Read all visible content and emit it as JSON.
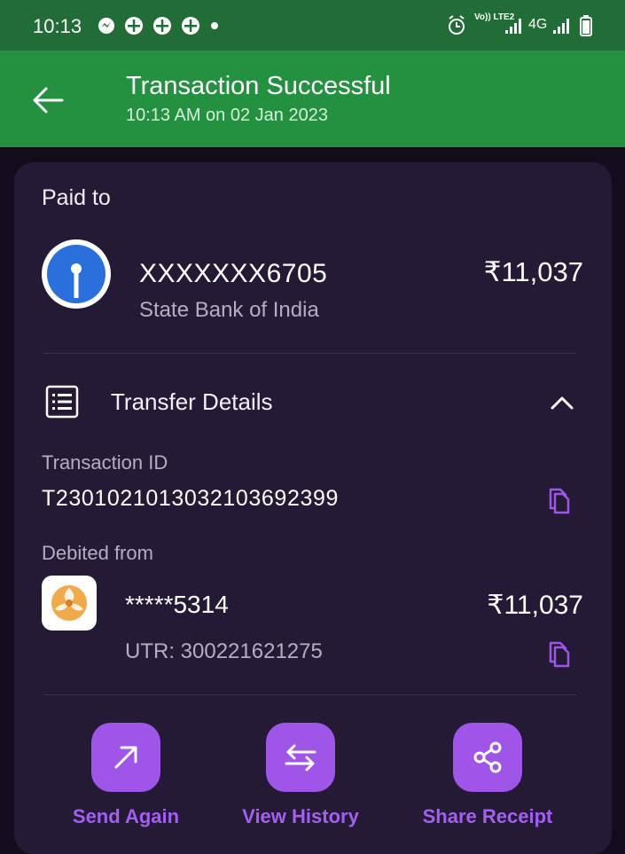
{
  "status_bar": {
    "time": "10:13",
    "network": "4G",
    "volte": "Vo)) LTE2"
  },
  "header": {
    "title": "Transaction Successful",
    "subtitle": "10:13 AM on 02 Jan 2023"
  },
  "paid_to": {
    "label": "Paid to",
    "account": "XXXXXXX6705",
    "bank_name": "State Bank of India",
    "amount": "₹11,037"
  },
  "transfer_details": {
    "title": "Transfer Details",
    "transaction_id_label": "Transaction ID",
    "transaction_id": "T2301021013032103692399",
    "debited_from_label": "Debited from",
    "debit_account": "*****5314",
    "debit_amount": "₹11,037",
    "utr": "UTR: 300221621275"
  },
  "actions": [
    {
      "label": "Send Again",
      "icon": "arrow-up-right-icon"
    },
    {
      "label": "View History",
      "icon": "swap-arrows-icon"
    },
    {
      "label": "Share Receipt",
      "icon": "share-icon"
    }
  ],
  "colors": {
    "status_bar": "#216c37",
    "header": "#23913f",
    "background": "#140b1c",
    "card": "#241a35",
    "accent": "#9e55e8"
  }
}
